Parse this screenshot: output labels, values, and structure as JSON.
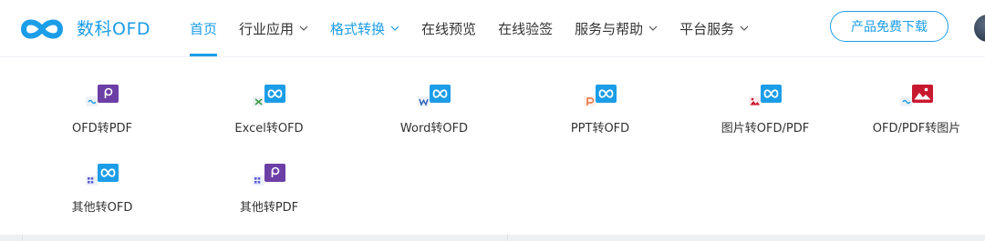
{
  "brand": {
    "name": "数科OFD"
  },
  "nav": {
    "items": [
      {
        "label": "首页",
        "has_dropdown": false
      },
      {
        "label": "行业应用",
        "has_dropdown": true
      },
      {
        "label": "格式转换",
        "has_dropdown": true
      },
      {
        "label": "在线预览",
        "has_dropdown": false
      },
      {
        "label": "在线验签",
        "has_dropdown": false
      },
      {
        "label": "服务与帮助",
        "has_dropdown": true
      },
      {
        "label": "平台服务",
        "has_dropdown": true
      }
    ]
  },
  "download_button": {
    "label": "产品免费下载"
  },
  "conversions": {
    "items": [
      {
        "label": "OFD转PDF",
        "icon": "ofd-to-pdf-icon"
      },
      {
        "label": "Excel转OFD",
        "icon": "excel-to-ofd-icon"
      },
      {
        "label": "Word转OFD",
        "icon": "word-to-ofd-icon"
      },
      {
        "label": "PPT转OFD",
        "icon": "ppt-to-ofd-icon"
      },
      {
        "label": "图片转OFD/PDF",
        "icon": "image-to-ofd-icon"
      },
      {
        "label": "OFD/PDF转图片",
        "icon": "ofd-pdf-to-image-icon"
      },
      {
        "label": "其他转OFD",
        "icon": "other-to-ofd-icon"
      },
      {
        "label": "其他转PDF",
        "icon": "other-to-pdf-icon"
      }
    ]
  },
  "colors": {
    "accent": "#1c9de8",
    "pdf_purple": "#6c3fa6",
    "image_red": "#c8182f"
  }
}
